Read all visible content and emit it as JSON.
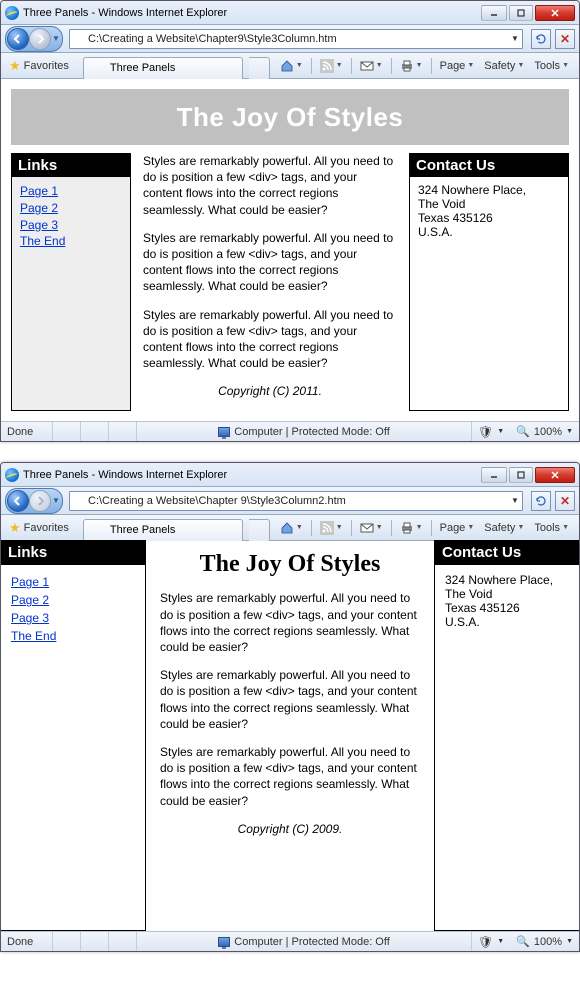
{
  "win1": {
    "title": "Three Panels - Windows Internet Explorer",
    "address": "C:\\Creating a Website\\Chapter9\\Style3Column.htm",
    "tab_label": "Three Panels",
    "favorites": "Favorites",
    "cmd": {
      "page": "Page",
      "safety": "Safety",
      "tools": "Tools"
    },
    "page": {
      "banner": "The Joy Of Styles",
      "links_title": "Links",
      "links": [
        "Page 1",
        "Page 2",
        "Page 3",
        "The End"
      ],
      "contact_title": "Contact Us",
      "contact_lines": [
        "324 Nowhere Place,",
        "The Void",
        "Texas 435126",
        "U.S.A."
      ],
      "para": "Styles are remarkably powerful. All you need to do is position a few <div> tags, and your content flows into the correct regions seamlessly. What could be easier?",
      "copyright": "Copyright (C) 2011."
    },
    "status": {
      "done": "Done",
      "mode": "Computer | Protected Mode: Off",
      "zoom": "100%"
    }
  },
  "win2": {
    "title": "Three Panels - Windows Internet Explorer",
    "address": "C:\\Creating a Website\\Chapter 9\\Style3Column2.htm",
    "tab_label": "Three Panels",
    "favorites": "Favorites",
    "cmd": {
      "page": "Page",
      "safety": "Safety",
      "tools": "Tools"
    },
    "page": {
      "heading": "The Joy Of Styles",
      "links_title": "Links",
      "links": [
        "Page 1",
        "Page 2",
        "Page 3",
        "The End"
      ],
      "contact_title": "Contact Us",
      "contact_lines": [
        "324 Nowhere Place,",
        "The Void",
        "Texas 435126",
        "U.S.A."
      ],
      "para": "Styles are remarkably powerful. All you need to do is position a few <div> tags, and your content flows into the correct regions seamlessly. What could be easier?",
      "copyright": "Copyright (C) 2009."
    },
    "status": {
      "done": "Done",
      "mode": "Computer | Protected Mode: Off",
      "zoom": "100%"
    }
  }
}
